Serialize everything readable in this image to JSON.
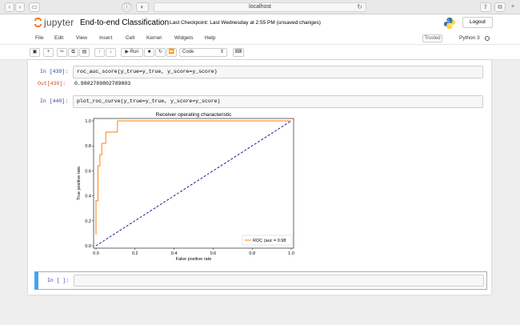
{
  "browser": {
    "url": "localhost"
  },
  "header": {
    "logo_text": "jupyter",
    "notebook_name": "End-to-end Classification",
    "checkpoint": "Last Checkpoint: Last Wednesday at 2:55 PM   (unsaved changes)",
    "logout_label": "Logout"
  },
  "menu": {
    "items": [
      "File",
      "Edit",
      "View",
      "Insert",
      "Cell",
      "Kernel",
      "Widgets",
      "Help"
    ],
    "trusted_label": "Trusted",
    "kernel_name": "Python 3"
  },
  "toolbar": {
    "run_label": "Run",
    "cell_type": "Code"
  },
  "cells": [
    {
      "prompt": "In [439]:",
      "code": "roc_auc_score(y_true=y_true, y_score=y_score)",
      "out_prompt": "Out[439]:",
      "output": "0.9802789802789803"
    },
    {
      "prompt": "In [440]:",
      "code": "plot_roc_curve(y_true=y_true, y_score=y_score)"
    },
    {
      "prompt": "In [ ]:"
    }
  ],
  "chart_data": {
    "type": "line",
    "title": "Receiver operating characteristic",
    "xlabel": "False positive rate",
    "ylabel": "True positive rate",
    "xlim": [
      0,
      1
    ],
    "ylim": [
      0,
      1
    ],
    "x_ticks": [
      "0.0",
      "0.2",
      "0.4",
      "0.6",
      "0.8",
      "1.0"
    ],
    "y_ticks": [
      "0.0",
      "0.2",
      "0.4",
      "0.6",
      "0.8",
      "1.0"
    ],
    "legend_position": "bottom-right",
    "series": [
      {
        "name": "ROC (auc = 0.98",
        "color": "#ff7f0e",
        "style": "solid",
        "x": [
          0.0,
          0.0,
          0.01,
          0.01,
          0.02,
          0.02,
          0.03,
          0.03,
          0.05,
          0.05,
          0.07,
          0.07,
          0.11,
          0.11,
          1.0
        ],
        "y": [
          0.09,
          0.36,
          0.36,
          0.64,
          0.64,
          0.73,
          0.73,
          0.82,
          0.82,
          0.91,
          0.91,
          0.91,
          0.91,
          1.0,
          1.0
        ]
      },
      {
        "color": "#1f1f8f",
        "style": "dashed",
        "x": [
          0.0,
          1.0
        ],
        "y": [
          0.0,
          1.0
        ]
      }
    ],
    "grid": false
  }
}
